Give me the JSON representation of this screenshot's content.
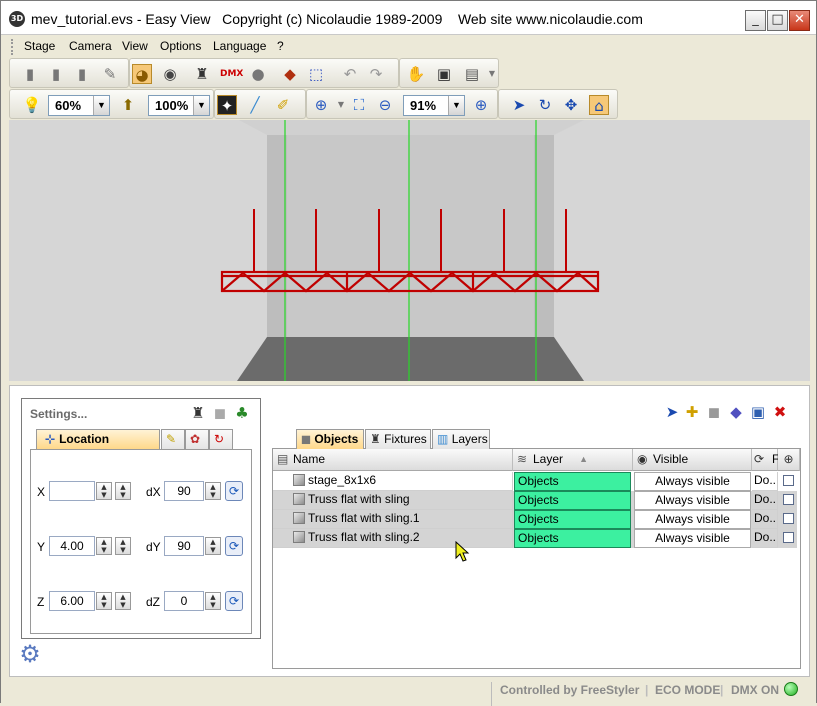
{
  "window": {
    "app_icon": "3D",
    "title": "mev_tutorial.evs - Easy View   Copyright (c) Nicolaudie 1989-2009    Web site www.nicolaudie.com",
    "minimize": "_",
    "maximize": "□",
    "close": "✕"
  },
  "menu": {
    "items": [
      "Stage",
      "Camera",
      "View",
      "Options",
      "Language",
      "?"
    ]
  },
  "toolbar2": {
    "light": "60%",
    "scale": "100%",
    "zoom": "91%"
  },
  "settings": {
    "title": "Settings...",
    "tab_location": "Location",
    "x_label": "X",
    "x_value": "",
    "y_label": "Y",
    "y_value": "4.00",
    "z_label": "Z",
    "z_value": "6.00",
    "dx_label": "dX",
    "dx_value": "90",
    "dy_label": "dY",
    "dy_value": "90",
    "dz_label": "dZ",
    "dz_value": "0"
  },
  "objects": {
    "tabs": [
      "Objects",
      "Fixtures",
      "Layers"
    ],
    "columns": {
      "name": "Name",
      "layer": "Layer",
      "visible": "Visible",
      "extra": "F"
    },
    "rows": [
      {
        "name": "stage_8x1x6",
        "layer": "Objects",
        "visible": "Always visible",
        "extra": "Do..."
      },
      {
        "name": "Truss flat with sling",
        "layer": "Objects",
        "visible": "Always visible",
        "extra": "Do..."
      },
      {
        "name": "Truss flat with sling.1",
        "layer": "Objects",
        "visible": "Always visible",
        "extra": "Do..."
      },
      {
        "name": "Truss flat with sling.2",
        "layer": "Objects",
        "visible": "Always visible",
        "extra": "Do..."
      }
    ]
  },
  "status": {
    "controlled": "Controlled by FreeStyler",
    "eco": "ECO MODE",
    "dmx": "DMX ON"
  },
  "colors": {
    "layer_green": "#3cf0a0",
    "truss_red": "#c00000",
    "beam_green": "#27d827"
  }
}
